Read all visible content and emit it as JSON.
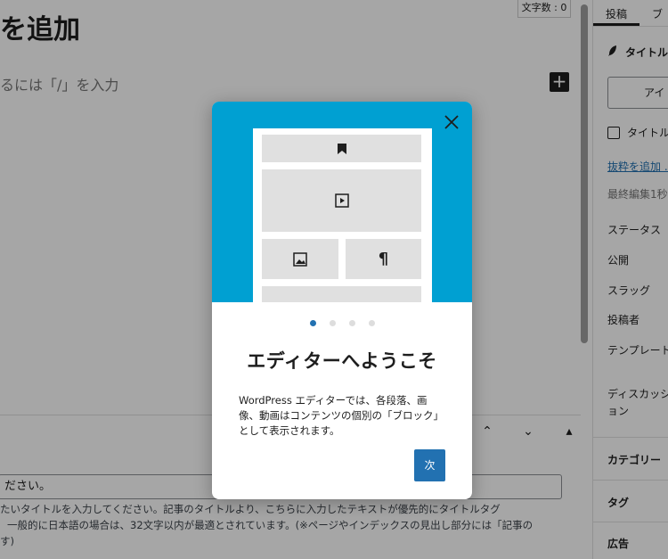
{
  "editor": {
    "word_count": "文字数 : 0",
    "post_title": "を追加",
    "block_hint": "るには「/」を入力",
    "add_block_symbol": "+"
  },
  "meta_box": {
    "controls": [
      "⌃",
      "⌄",
      "▴"
    ],
    "input_value": " ださい。",
    "description_lines": [
      "たいタイトルを入力してください。記事のタイトルより、こちらに入力したテキストが優先的にタイトルタグ",
      "一般的に日本語の場合は、32文字以内が最適とされています。(※ページやインデックスの見出し部分には「記事の",
      "す)"
    ]
  },
  "sidebar": {
    "tabs": [
      "投稿",
      "ブ"
    ],
    "title_row": "タイトル",
    "ai_button": "アイ",
    "checkbox_label": "タイトル",
    "excerpt_link": "抜粋を追加 ...",
    "last_edited": "最終編集1秒",
    "fields": [
      "ステータス",
      "公開",
      "スラッグ",
      "投稿者",
      "テンプレート",
      "ディスカッシ",
      "ョン"
    ],
    "panels": [
      "カテゴリー",
      "タグ",
      "広告"
    ]
  },
  "modal": {
    "dots_total": 4,
    "active_dot": 0,
    "heading": "エディターへようこそ",
    "body": "WordPress エディターでは、各段落、画像、動画はコンテンツの個別の「ブロック」として表示されます。",
    "next_button": "次",
    "header_color": "#00a0d2",
    "accent": "#2271b1"
  }
}
